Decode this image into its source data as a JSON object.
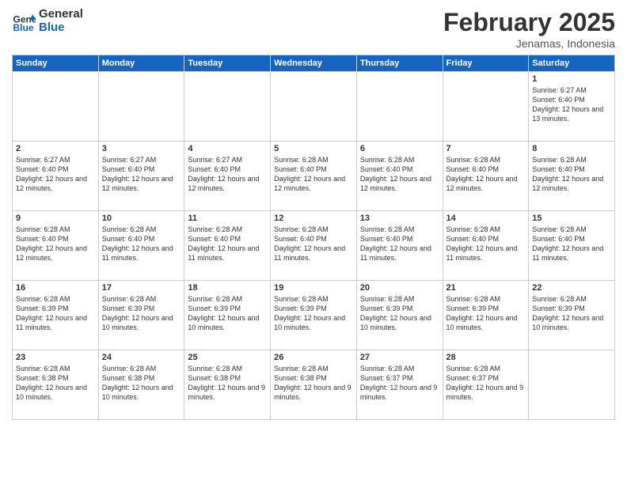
{
  "header": {
    "logo_line1": "General",
    "logo_line2": "Blue",
    "month": "February 2025",
    "location": "Jenamas, Indonesia"
  },
  "weekdays": [
    "Sunday",
    "Monday",
    "Tuesday",
    "Wednesday",
    "Thursday",
    "Friday",
    "Saturday"
  ],
  "weeks": [
    [
      {
        "day": "",
        "info": ""
      },
      {
        "day": "",
        "info": ""
      },
      {
        "day": "",
        "info": ""
      },
      {
        "day": "",
        "info": ""
      },
      {
        "day": "",
        "info": ""
      },
      {
        "day": "",
        "info": ""
      },
      {
        "day": "1",
        "info": "Sunrise: 6:27 AM\nSunset: 6:40 PM\nDaylight: 12 hours\nand 13 minutes."
      }
    ],
    [
      {
        "day": "2",
        "info": "Sunrise: 6:27 AM\nSunset: 6:40 PM\nDaylight: 12 hours\nand 12 minutes."
      },
      {
        "day": "3",
        "info": "Sunrise: 6:27 AM\nSunset: 6:40 PM\nDaylight: 12 hours\nand 12 minutes."
      },
      {
        "day": "4",
        "info": "Sunrise: 6:27 AM\nSunset: 6:40 PM\nDaylight: 12 hours\nand 12 minutes."
      },
      {
        "day": "5",
        "info": "Sunrise: 6:28 AM\nSunset: 6:40 PM\nDaylight: 12 hours\nand 12 minutes."
      },
      {
        "day": "6",
        "info": "Sunrise: 6:28 AM\nSunset: 6:40 PM\nDaylight: 12 hours\nand 12 minutes."
      },
      {
        "day": "7",
        "info": "Sunrise: 6:28 AM\nSunset: 6:40 PM\nDaylight: 12 hours\nand 12 minutes."
      },
      {
        "day": "8",
        "info": "Sunrise: 6:28 AM\nSunset: 6:40 PM\nDaylight: 12 hours\nand 12 minutes."
      }
    ],
    [
      {
        "day": "9",
        "info": "Sunrise: 6:28 AM\nSunset: 6:40 PM\nDaylight: 12 hours\nand 12 minutes."
      },
      {
        "day": "10",
        "info": "Sunrise: 6:28 AM\nSunset: 6:40 PM\nDaylight: 12 hours\nand 11 minutes."
      },
      {
        "day": "11",
        "info": "Sunrise: 6:28 AM\nSunset: 6:40 PM\nDaylight: 12 hours\nand 11 minutes."
      },
      {
        "day": "12",
        "info": "Sunrise: 6:28 AM\nSunset: 6:40 PM\nDaylight: 12 hours\nand 11 minutes."
      },
      {
        "day": "13",
        "info": "Sunrise: 6:28 AM\nSunset: 6:40 PM\nDaylight: 12 hours\nand 11 minutes."
      },
      {
        "day": "14",
        "info": "Sunrise: 6:28 AM\nSunset: 6:40 PM\nDaylight: 12 hours\nand 11 minutes."
      },
      {
        "day": "15",
        "info": "Sunrise: 6:28 AM\nSunset: 6:40 PM\nDaylight: 12 hours\nand 11 minutes."
      }
    ],
    [
      {
        "day": "16",
        "info": "Sunrise: 6:28 AM\nSunset: 6:39 PM\nDaylight: 12 hours\nand 11 minutes."
      },
      {
        "day": "17",
        "info": "Sunrise: 6:28 AM\nSunset: 6:39 PM\nDaylight: 12 hours\nand 10 minutes."
      },
      {
        "day": "18",
        "info": "Sunrise: 6:28 AM\nSunset: 6:39 PM\nDaylight: 12 hours\nand 10 minutes."
      },
      {
        "day": "19",
        "info": "Sunrise: 6:28 AM\nSunset: 6:39 PM\nDaylight: 12 hours\nand 10 minutes."
      },
      {
        "day": "20",
        "info": "Sunrise: 6:28 AM\nSunset: 6:39 PM\nDaylight: 12 hours\nand 10 minutes."
      },
      {
        "day": "21",
        "info": "Sunrise: 6:28 AM\nSunset: 6:39 PM\nDaylight: 12 hours\nand 10 minutes."
      },
      {
        "day": "22",
        "info": "Sunrise: 6:28 AM\nSunset: 6:39 PM\nDaylight: 12 hours\nand 10 minutes."
      }
    ],
    [
      {
        "day": "23",
        "info": "Sunrise: 6:28 AM\nSunset: 6:38 PM\nDaylight: 12 hours\nand 10 minutes."
      },
      {
        "day": "24",
        "info": "Sunrise: 6:28 AM\nSunset: 6:38 PM\nDaylight: 12 hours\nand 10 minutes."
      },
      {
        "day": "25",
        "info": "Sunrise: 6:28 AM\nSunset: 6:38 PM\nDaylight: 12 hours\nand 9 minutes."
      },
      {
        "day": "26",
        "info": "Sunrise: 6:28 AM\nSunset: 6:38 PM\nDaylight: 12 hours\nand 9 minutes."
      },
      {
        "day": "27",
        "info": "Sunrise: 6:28 AM\nSunset: 6:37 PM\nDaylight: 12 hours\nand 9 minutes."
      },
      {
        "day": "28",
        "info": "Sunrise: 6:28 AM\nSunset: 6:37 PM\nDaylight: 12 hours\nand 9 minutes."
      },
      {
        "day": "",
        "info": ""
      }
    ]
  ]
}
